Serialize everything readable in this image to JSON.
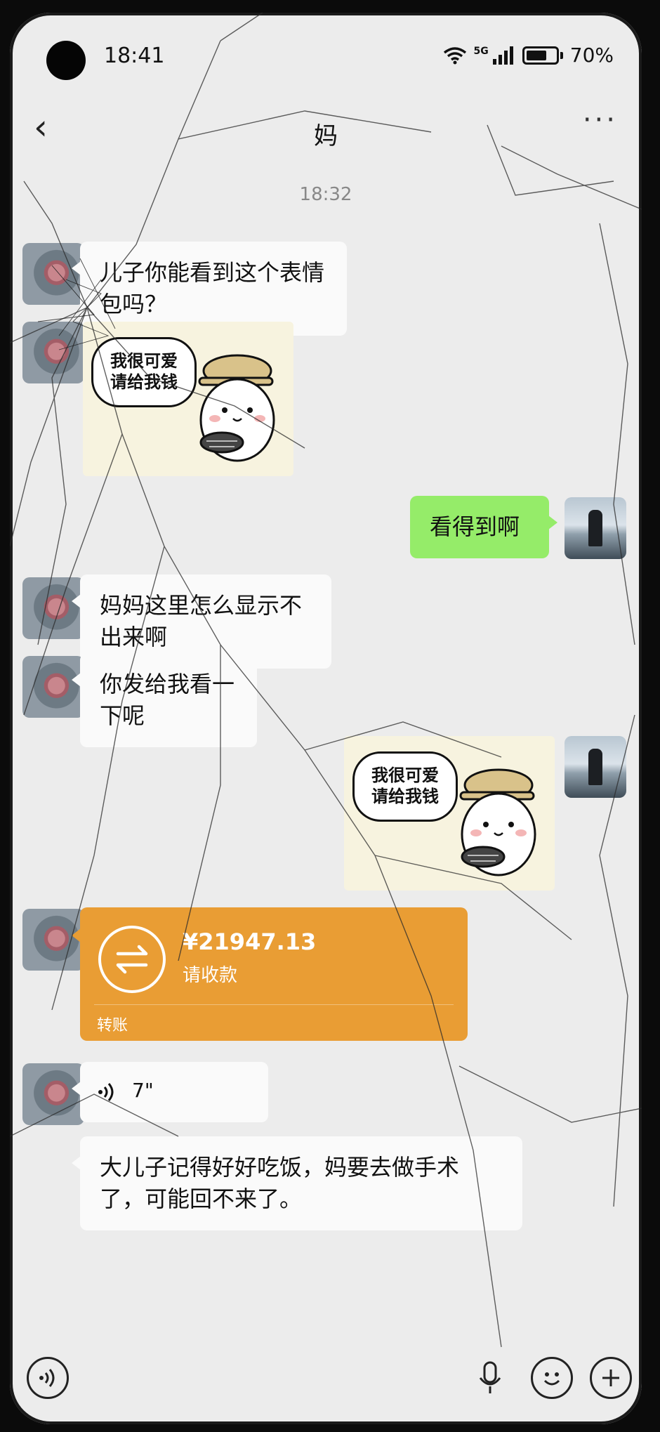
{
  "status_bar": {
    "time": "18:41",
    "network": "5G",
    "battery": "70%"
  },
  "header": {
    "title": "妈"
  },
  "chat": {
    "timestamp": "18:32",
    "messages": [
      {
        "from": "them",
        "type": "text",
        "text": "儿子你能看到这个表情包吗？"
      },
      {
        "from": "them",
        "type": "sticker",
        "line1": "我很可爱",
        "line2": "请给我钱"
      },
      {
        "from": "me",
        "type": "text",
        "text": "看得到啊"
      },
      {
        "from": "them",
        "type": "text",
        "text": "妈妈这里怎么显示不出来啊"
      },
      {
        "from": "them",
        "type": "text",
        "text": "你发给我看一下呢"
      },
      {
        "from": "me",
        "type": "sticker",
        "line1": "我很可爱",
        "line2": "请给我钱"
      },
      {
        "from": "them",
        "type": "transfer",
        "amount": "¥21947.13",
        "status": "请收款",
        "label": "转账"
      },
      {
        "from": "them",
        "type": "voice",
        "duration": "7\""
      },
      {
        "from": "them",
        "type": "text",
        "text": "大儿子记得好好吃饭，妈要去做手术了，可能回不来了。"
      }
    ]
  },
  "icons": {
    "back": "back-arrow-icon",
    "more": "more-icon",
    "voice_input": "voice-mode-icon",
    "mic": "microphone-icon",
    "emoji": "emoji-icon",
    "plus": "plus-icon"
  },
  "colors": {
    "my_bubble": "#95ec69",
    "transfer": "#e99d34",
    "background": "#ececec"
  }
}
